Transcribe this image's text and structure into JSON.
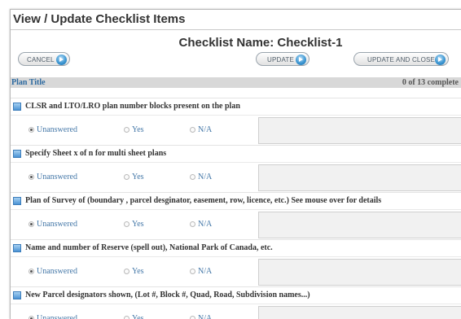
{
  "window": {
    "title": "View / Update Checklist Items"
  },
  "checklist": {
    "name_label": "Checklist Name: Checklist-1"
  },
  "buttons": {
    "cancel": "CANCEL",
    "update": "UPDATE",
    "update_and_close": "UPDATE AND CLOSE"
  },
  "section": {
    "title": "Plan Title",
    "progress": "0 of 13 complete"
  },
  "options": {
    "unanswered": "Unanswered",
    "yes": "Yes",
    "na": "N/A"
  },
  "items": [
    {
      "label": "CLSR and LTO/LRO plan number blocks present on the plan",
      "selected": "unanswered"
    },
    {
      "label": "Specify Sheet x of n for multi sheet plans",
      "selected": "unanswered"
    },
    {
      "label": "Plan of Survey of (boundary , parcel desginator, easement, row, licence, etc.) See mouse over for details",
      "selected": "unanswered"
    },
    {
      "label": "Name and number of Reserve (spell out), National Park of Canada, etc.",
      "selected": "unanswered"
    },
    {
      "label": "New Parcel designators shown, (Lot #, Block #, Quad, Road, Subdivision names...)",
      "selected": "unanswered"
    }
  ],
  "colors": {
    "accent": "#2d6aa0",
    "link": "#4578a8",
    "section_bg": "#d8d8d8",
    "icon": "#3d97d3"
  },
  "icons": {
    "button_icon": "arrow-circle-icon",
    "item_icon": "checklist-square-icon"
  }
}
